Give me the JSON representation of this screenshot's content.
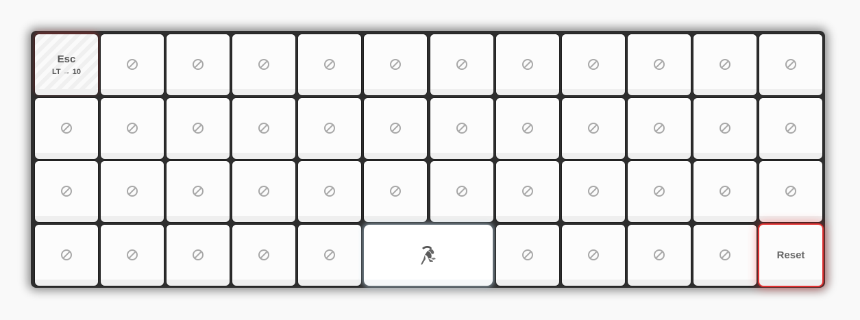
{
  "keyboard": {
    "rows": 4,
    "cols": 12,
    "esc_key": {
      "label": "Esc",
      "sublabel": "LT → 10"
    },
    "reset_key": {
      "label": "Reset"
    },
    "space_key": {
      "icon": "gazelle-logo-icon"
    },
    "empty_key_icon": "blocked-icon"
  }
}
